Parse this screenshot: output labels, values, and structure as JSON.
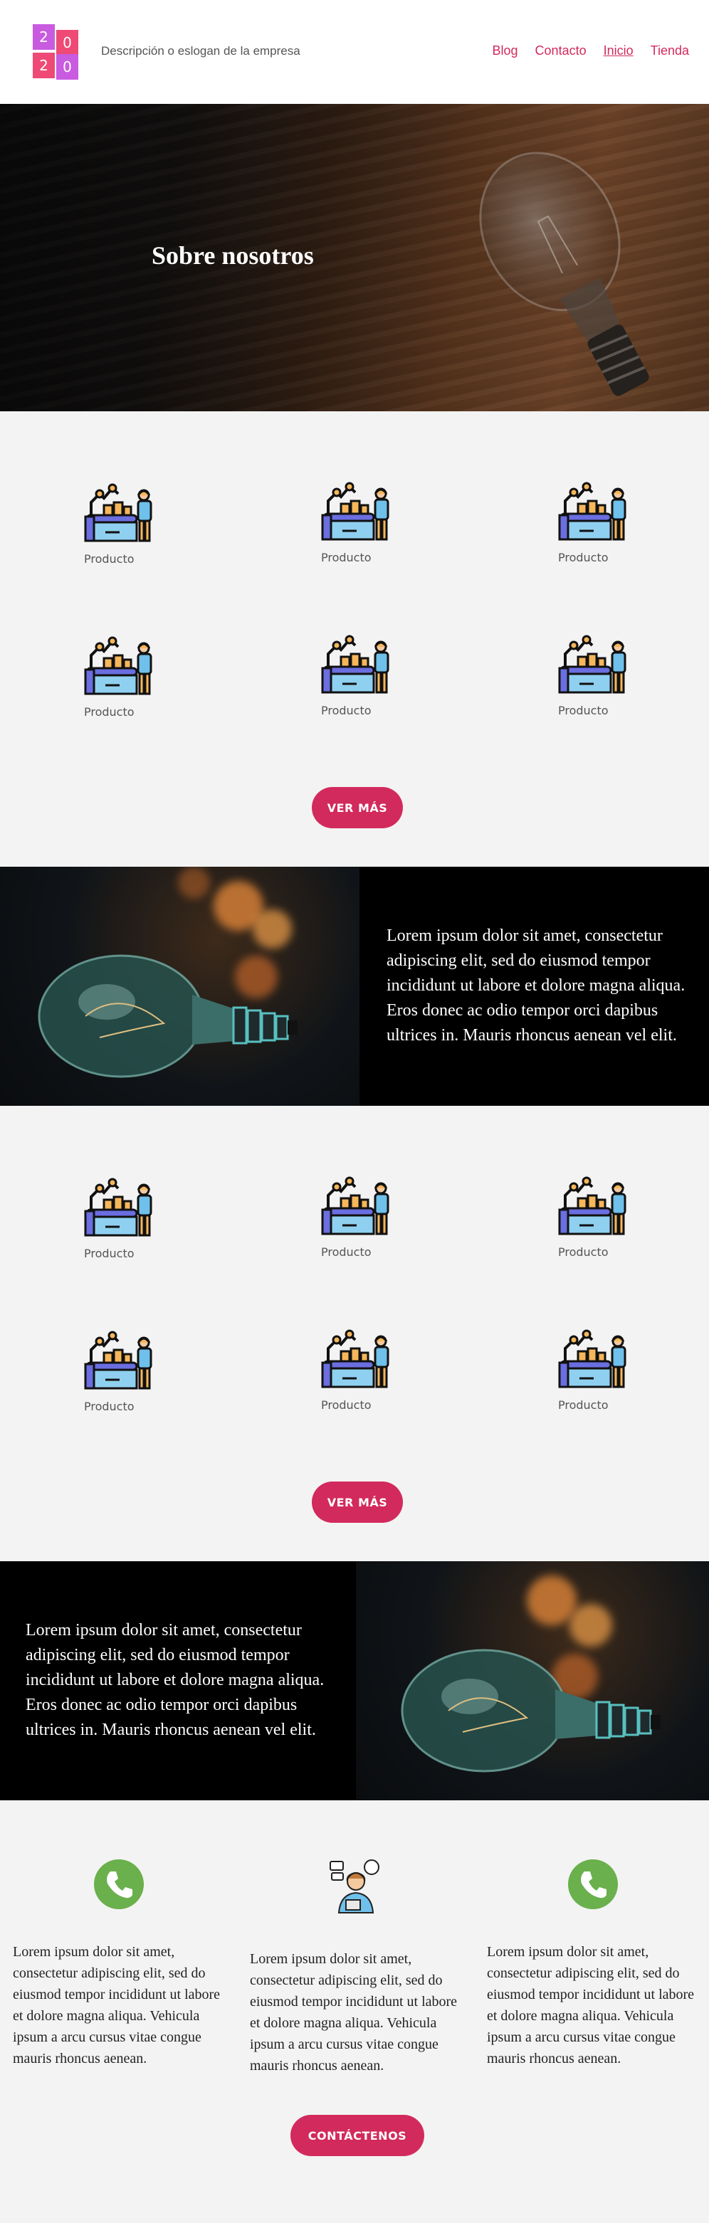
{
  "header": {
    "logo_chars": [
      "2",
      "0",
      "2",
      "0"
    ],
    "tagline": "Descripción o eslogan de la empresa",
    "nav": [
      {
        "label": "Blog",
        "active": false
      },
      {
        "label": "Contacto",
        "active": false
      },
      {
        "label": "Inicio",
        "active": true
      },
      {
        "label": "Tienda",
        "active": false
      }
    ]
  },
  "hero": {
    "title": "Sobre nosotros"
  },
  "products_1": {
    "items": [
      "Producto",
      "Producto",
      "Producto",
      "Producto",
      "Producto",
      "Producto"
    ],
    "button": "VER MÁS"
  },
  "split_1": {
    "text": "Lorem ipsum dolor sit amet, consectetur adipiscing elit, sed do eiusmod tempor incididunt ut labore et dolore magna aliqua. Eros donec ac odio tempor orci dapibus ultrices in. Mauris rhoncus aenean vel elit."
  },
  "products_2": {
    "items": [
      "Producto",
      "Producto",
      "Producto",
      "Producto",
      "Producto",
      "Producto"
    ],
    "button": "VER MÁS"
  },
  "split_2": {
    "text": "Lorem ipsum dolor sit amet, consectetur adipiscing elit, sed do eiusmod tempor incididunt ut labore et dolore magna aliqua. Eros donec ac odio tempor orci dapibus ultrices in. Mauris rhoncus aenean vel elit."
  },
  "contact": {
    "columns": [
      {
        "icon": "phone-icon",
        "text": "Lorem ipsum dolor sit amet, consectetur adipiscing elit, sed do eiusmod tempor incididunt ut labore et dolore magna aliqua. Vehicula ipsum a arcu cursus vitae congue mauris rhoncus aenean."
      },
      {
        "icon": "support-agent-icon",
        "text": "Lorem ipsum dolor sit amet, consectetur adipiscing elit, sed do eiusmod tempor incididunt ut labore et dolore magna aliqua. Vehicula ipsum a arcu cursus vitae congue mauris rhoncus aenean."
      },
      {
        "icon": "phone-icon",
        "text": "Lorem ipsum dolor sit amet, consectetur adipiscing elit, sed do eiusmod tempor incididunt ut labore et dolore magna aliqua. Vehicula ipsum a arcu cursus vitae congue mauris rhoncus aenean."
      }
    ],
    "button": "CONTÁCTENOS"
  },
  "colors": {
    "accent": "#d22a5c",
    "logo_purple": "#c95be0",
    "logo_pink": "#ee4a75",
    "phone_green": "#6ab04c",
    "background": "#f3f3f3"
  }
}
